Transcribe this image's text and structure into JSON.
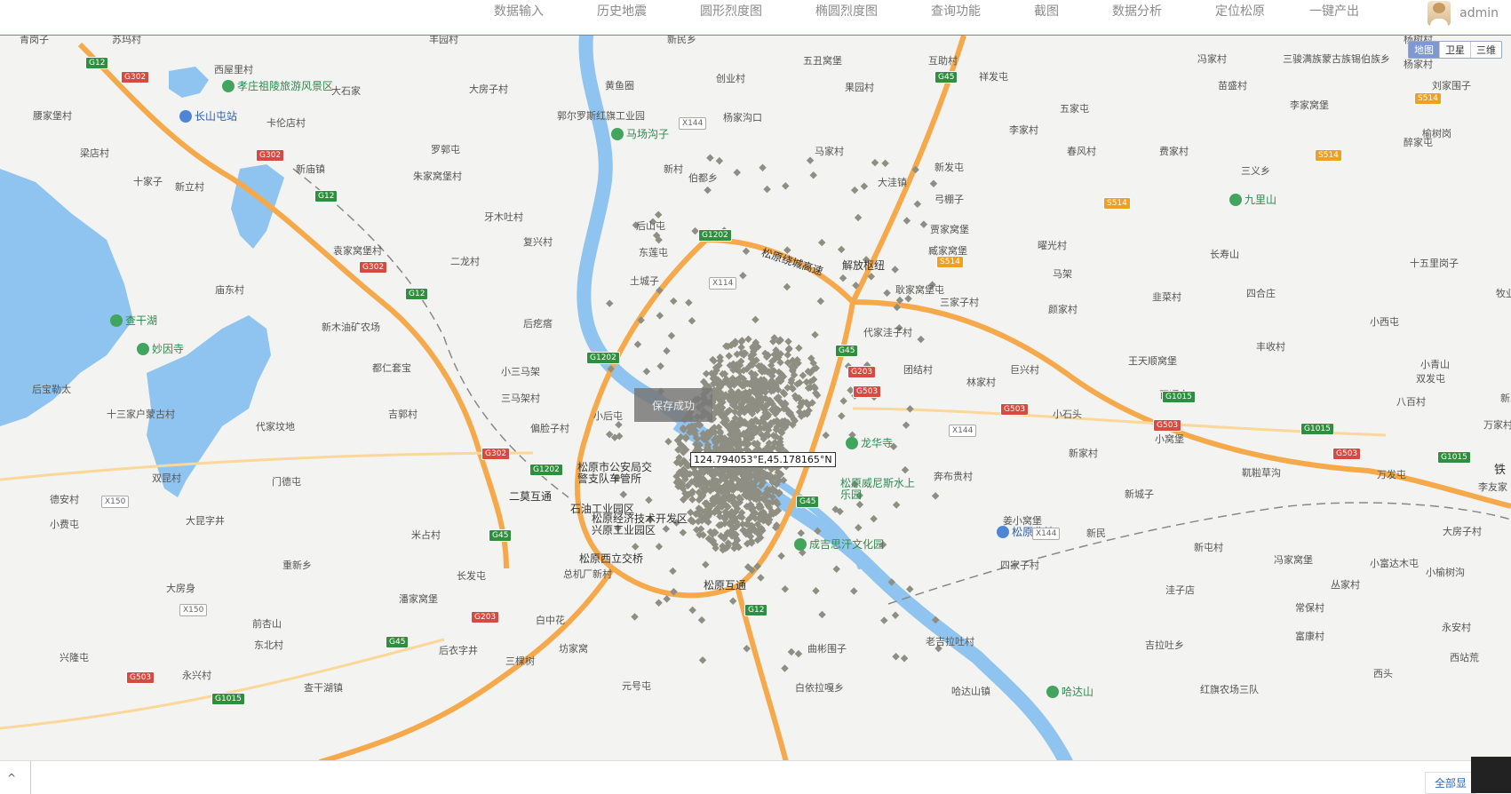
{
  "nav": {
    "items": [
      "数据输入",
      "历史地震",
      "圆形烈度图",
      "椭圆烈度图",
      "查询功能",
      "截图",
      "数据分析",
      "定位松原",
      "一键产出"
    ],
    "user": "admin"
  },
  "map": {
    "type_buttons": [
      "地图",
      "卫星",
      "三维"
    ],
    "toast": "保存成功",
    "coordinate": "124.794053°E,45.178165°N",
    "place_labels": [
      "青岗子",
      "苏玛村",
      "丰园村",
      "新民乡",
      "五丑窝堡",
      "互助村",
      "冯家村",
      "三骏满族蒙古族锡伯族乡",
      "杨家村",
      "杨树村",
      "西屋里村",
      "大石家",
      "大房子村",
      "创业村",
      "果园村",
      "祥发屯",
      "苗盛村",
      "刘家围子",
      "腰家堡村",
      "长山屯站",
      "卡伦店村",
      "黄鱼圈",
      "杨家沟口",
      "五家屯",
      "李家窝堡",
      "梁店村",
      "罗郭屯",
      "马家村",
      "李家村",
      "春风村",
      "费家村",
      "醉家屯",
      "榆树岗",
      "十家子",
      "新立村",
      "新庙镇",
      "朱家窝堡村",
      "新村",
      "伯都乡",
      "大洼镇",
      "新发屯",
      "三义乡",
      "牙木吐村",
      "弓棚子",
      "九里山",
      "复兴村",
      "后山屯",
      "贾家窝堡",
      "臧家窝堡",
      "长寿山",
      "曜光村",
      "十五里岗子",
      "袁家窝堡村",
      "二龙村",
      "东莲屯",
      "马架",
      "庙东村",
      "土城子",
      "耿家窝堡屯",
      "三家子村",
      "四合庄",
      "韭菜村",
      "颜家村",
      "牧业",
      "新木油矿农场",
      "后疙瘩",
      "代家洼子村",
      "小西屯",
      "丰收村",
      "王天顺窝堡",
      "小青山",
      "都仁套宝",
      "小三马架",
      "团结村",
      "林家村",
      "巨兴村",
      "双发屯",
      "三马架村",
      "百顺合",
      "八百村",
      "后宝勒太",
      "十三家户蒙古村",
      "吉郭村",
      "小后屯",
      "新发村",
      "三十堡",
      "小石头",
      "代家坟地",
      "偏脸子村",
      "奔布贵村",
      "新家村",
      "小窝堡",
      "靰鞡草沟",
      "万发屯",
      "万家村",
      "李友家",
      "德安村",
      "双昆村",
      "门德屯",
      "门德村",
      "新城子",
      "冯家窝堡",
      "大房子村",
      "小费屯",
      "大昆字井",
      "米占村",
      "新立屯",
      "新民",
      "姜小窝堡",
      "新屯村",
      "小榆树沟",
      "大房身",
      "重新乡",
      "长发屯",
      "四家子村",
      "小富达木屯",
      "丛家村",
      "前杏山",
      "潘家窝堡",
      "总机厂新村",
      "洼子店",
      "常保村",
      "东北村",
      "白中花",
      "坊家窝",
      "曲彬围子",
      "老吉拉吐村",
      "吉拉吐乡",
      "富康村",
      "永安村",
      "西站荒",
      "兴隆屯",
      "后衣字井",
      "三棵树",
      "西头",
      "永兴村",
      "查干湖镇",
      "元号屯",
      "白依拉嘎乡",
      "红旗农场三队",
      "哈达山镇",
      "郭尔罗斯红旗工业园",
      "松花江"
    ],
    "road_labels": [
      "松原绕城高速",
      "解放枢纽",
      "二莫互通",
      "松原西立交桥",
      "松原互通"
    ],
    "pois": [
      "孝庄祖陵旅游风景区",
      "长山屯站",
      "马场沟子",
      "查干湖",
      "妙因寺",
      "松原市公安局交警支队车管所",
      "石油工业园区",
      "松原经济技术开发区兴原工业园区",
      "龙华寺",
      "松原威尼斯水上乐园",
      "成吉思汗文化园",
      "松原北站",
      "哈达山",
      "九里山",
      "铁"
    ],
    "shields": [
      "G12",
      "G302",
      "G302",
      "G12",
      "G302",
      "G12",
      "G1202",
      "G1202",
      "G1202",
      "G302",
      "G45",
      "G45",
      "G45",
      "G45",
      "G203",
      "G503",
      "G203",
      "G503",
      "G503",
      "G503",
      "G1015",
      "G1015",
      "G1015",
      "G12",
      "S514",
      "S514",
      "S514",
      "S514",
      "X144",
      "X114",
      "X144",
      "X144",
      "X150",
      "X150",
      "G503",
      "G1015",
      "G45"
    ]
  },
  "bottom": {
    "collapse_icon": "chevron-up-icon",
    "show_all": "全部显"
  },
  "colors": {
    "water": "#8ec4ef",
    "highway": "#f5a94b",
    "road": "#fbd79a",
    "scatter": "#8f8e82",
    "accent": "#3aa597"
  }
}
